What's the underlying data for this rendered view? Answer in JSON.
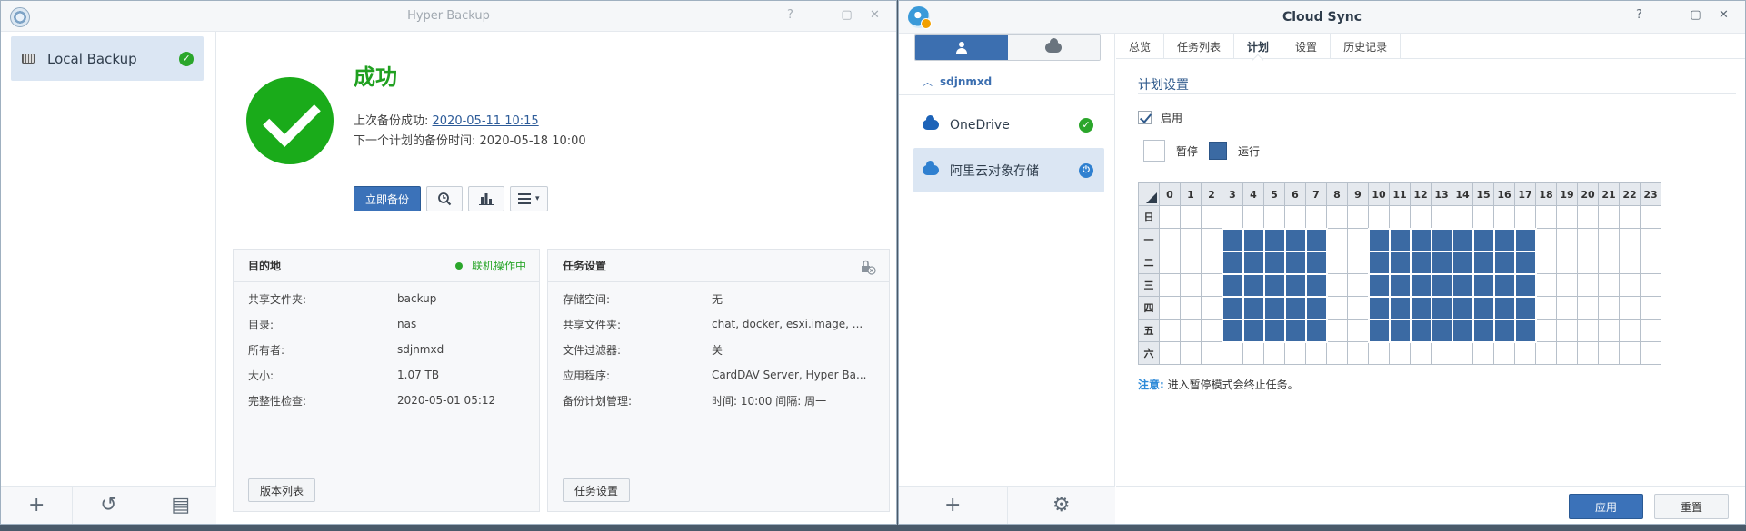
{
  "hyper_backup": {
    "title": "Hyper Backup",
    "controls": {
      "help": "?",
      "minimize": "—",
      "maximize": "▢",
      "close": "✕"
    },
    "sidebar": {
      "items": [
        {
          "label": "Local Backup",
          "status_icon": "check-icon"
        }
      ]
    },
    "status": {
      "title": "成功",
      "last_label": "上次备份成功: ",
      "last_time": "2020-05-11 10:15",
      "next_text": "下一个计划的备份时间: 2020-05-18 10:00"
    },
    "toolbar": {
      "backup_now": "立即备份"
    },
    "destination": {
      "title": "目的地",
      "online": "联机操作中",
      "rows": [
        {
          "k": "共享文件夹:",
          "v": "backup"
        },
        {
          "k": "目录:",
          "v": "nas"
        },
        {
          "k": "所有者:",
          "v": "sdjnmxd"
        },
        {
          "k": "大小:",
          "v": "1.07 TB"
        },
        {
          "k": "完整性检查:",
          "v": "2020-05-01 05:12"
        }
      ],
      "button": "版本列表"
    },
    "task": {
      "title": "任务设置",
      "rows": [
        {
          "k": "存储空间:",
          "v": "无"
        },
        {
          "k": "共享文件夹:",
          "v": "chat, docker, esxi.image, ..."
        },
        {
          "k": "文件过滤器:",
          "v": "关"
        },
        {
          "k": "应用程序:",
          "v": "CardDAV Server, Hyper Ba..."
        },
        {
          "k": "备份计划管理:",
          "v": "时间: 10:00 间隔: 周一"
        }
      ],
      "button": "任务设置"
    }
  },
  "cloud_sync": {
    "title": "Cloud Sync",
    "controls": {
      "help": "?",
      "minimize": "—",
      "maximize": "▢",
      "close": "✕"
    },
    "sidebar": {
      "user": "sdjnmxd",
      "items": [
        {
          "label": "OneDrive",
          "color": "#1d63b8"
        },
        {
          "label": "阿里云对象存储",
          "color": "#2f80d0"
        }
      ]
    },
    "tabs": [
      "总览",
      "任务列表",
      "计划",
      "设置",
      "历史记录"
    ],
    "active_tab": "计划",
    "schedule": {
      "title": "计划设置",
      "enable_label": "启用",
      "pause_label": "暂停",
      "run_label": "运行",
      "hours": [
        "0",
        "1",
        "2",
        "3",
        "4",
        "5",
        "6",
        "7",
        "8",
        "9",
        "10",
        "11",
        "12",
        "13",
        "14",
        "15",
        "16",
        "17",
        "18",
        "19",
        "20",
        "21",
        "22",
        "23"
      ],
      "days": [
        "日",
        "一",
        "二",
        "三",
        "四",
        "五",
        "六"
      ],
      "active_hours_weekdays": [
        3,
        4,
        5,
        6,
        7,
        10,
        11,
        12,
        13,
        14,
        15,
        16,
        17
      ],
      "active_days": [
        "一",
        "二",
        "三",
        "四",
        "五"
      ]
    },
    "note_label": "注意:",
    "note_text": " 进入暂停模式会终止任务。",
    "apply": "应用",
    "reset": "重置"
  }
}
